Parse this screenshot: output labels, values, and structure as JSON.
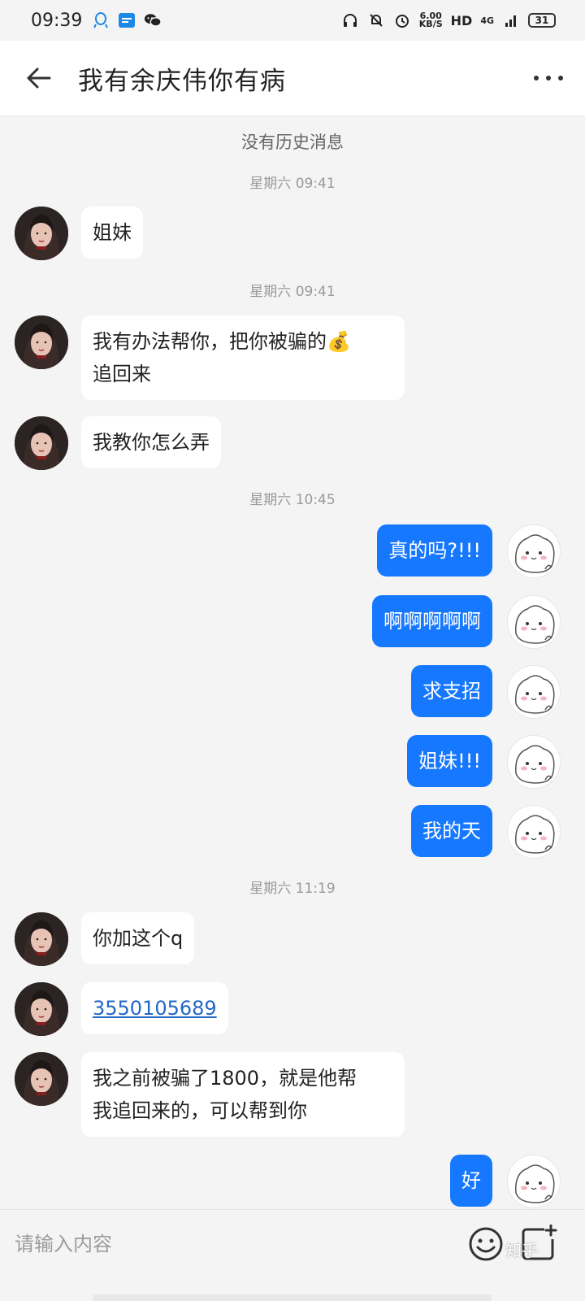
{
  "status_bar": {
    "time": "09:39",
    "speed_value": "6.00",
    "speed_unit": "KB/S",
    "hd": "HD",
    "network": "4G",
    "battery": "31"
  },
  "header": {
    "title": "我有余庆伟你有病"
  },
  "chat": {
    "no_history": "没有历史消息",
    "timestamps": [
      "星期六 09:41",
      "星期六 09:41",
      "星期六 10:45",
      "星期六 11:19"
    ],
    "messages": [
      {
        "side": "in",
        "text": "姐妹"
      },
      {
        "side": "in",
        "line1": "我有办法帮你，把你被骗的💰",
        "line2": "追回来"
      },
      {
        "side": "in",
        "text": "我教你怎么弄"
      },
      {
        "side": "out",
        "text": "真的吗?!!!"
      },
      {
        "side": "out",
        "text": "啊啊啊啊啊"
      },
      {
        "side": "out",
        "text": "求支招"
      },
      {
        "side": "out",
        "text": "姐妹!!!"
      },
      {
        "side": "out",
        "text": "我的天"
      },
      {
        "side": "in",
        "text": "你加这个q"
      },
      {
        "side": "in",
        "text": "3550105689"
      },
      {
        "side": "in",
        "line1": "我之前被骗了1800，就是他帮",
        "line2": "我追回来的，可以帮到你"
      },
      {
        "side": "out",
        "text": "好"
      }
    ]
  },
  "input": {
    "placeholder": "请输入内容"
  },
  "watermark": "知乎",
  "colors": {
    "outgoing_bubble": "#1678ff",
    "incoming_bubble": "#ffffff",
    "background": "#f4f4f5"
  },
  "icons": [
    "back-arrow-icon",
    "more-icon",
    "emoji-icon",
    "plus-icon"
  ]
}
